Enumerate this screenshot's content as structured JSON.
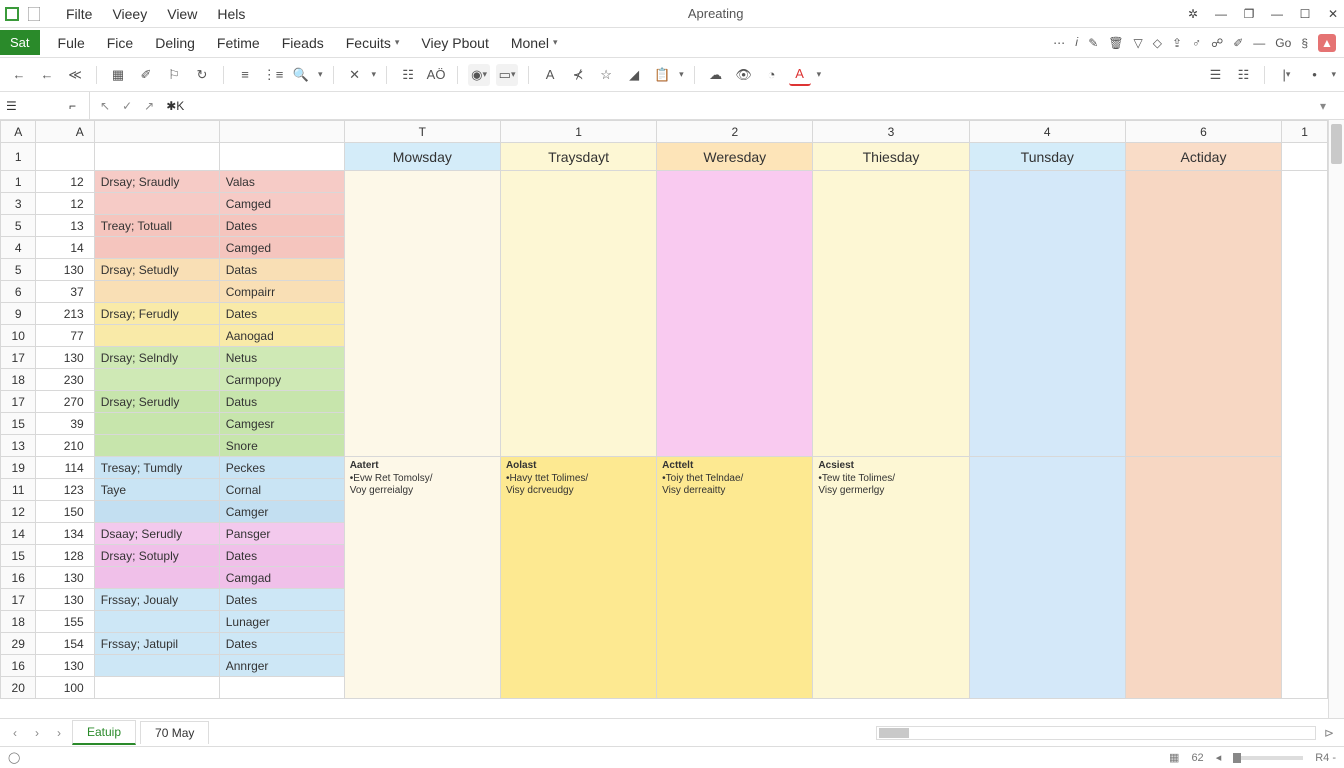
{
  "titlebar": {
    "menu": [
      "Filte",
      "Vieey",
      "View",
      "Hels"
    ],
    "center": "Apreating"
  },
  "ribbon": {
    "sat": "Sat",
    "items": [
      "Fule",
      "Fice",
      "Deling",
      "Fetime",
      "Fieads",
      "Fecuits",
      "Viey Pbout",
      "Monel"
    ],
    "go": "Go"
  },
  "formula": {
    "fx": "K"
  },
  "colHeaders": {
    "a1": "A",
    "a2": "A",
    "t": "T",
    "c1": "1",
    "c2": "2",
    "c3": "3",
    "c4": "4",
    "c6": "6",
    "c1r": "1"
  },
  "days": {
    "d1": "Mowsday",
    "d2": "Traysdayt",
    "d3": "Weresday",
    "d4": "Thiesday",
    "d5": "Tunsday",
    "d6": "Actiday"
  },
  "rows": [
    {
      "h": "1",
      "a": "",
      "b": "",
      "c": ""
    },
    {
      "h": "1",
      "a": "12",
      "b": "Drsay;  Sraudly",
      "c": "Valas",
      "cls": "c-red1"
    },
    {
      "h": "3",
      "a": "12",
      "b": "",
      "c": "Camged",
      "cls": "c-red1"
    },
    {
      "h": "5",
      "a": "13",
      "b": "Treay;  Totuall",
      "c": "Dates",
      "cls": "c-red2"
    },
    {
      "h": "4",
      "a": "14",
      "b": "",
      "c": "Camged",
      "cls": "c-red2"
    },
    {
      "h": "5",
      "a": "130",
      "b": "Drsay;  Setudly",
      "c": "Datas",
      "cls": "c-orn2"
    },
    {
      "h": "6",
      "a": "37",
      "b": "",
      "c": "Compairr",
      "cls": "c-orn2"
    },
    {
      "h": "9",
      "a": "213",
      "b": "Drsay;  Ferudly",
      "c": "Dates",
      "cls": "c-yel2"
    },
    {
      "h": "10",
      "a": "77",
      "b": "",
      "c": "Aanogad",
      "cls": "c-yel2"
    },
    {
      "h": "17",
      "a": "130",
      "b": "Drsay;  Selndly",
      "c": "Netus",
      "cls": "c-grn2"
    },
    {
      "h": "18",
      "a": "230",
      "b": "",
      "c": "Carmpopy",
      "cls": "c-grn2"
    },
    {
      "h": "17",
      "a": "270",
      "b": "Drsay;  Serudly",
      "c": "Datus",
      "cls": "c-grn3"
    },
    {
      "h": "15",
      "a": "39",
      "b": "",
      "c": "Camgesr",
      "cls": "c-grn3"
    },
    {
      "h": "13",
      "a": "210",
      "b": "",
      "c": "Snore",
      "cls": "c-grn3"
    },
    {
      "h": "19",
      "a": "114",
      "b": "Tresay;  Tumdly",
      "c": "Peckes",
      "cls": "c-blu3"
    },
    {
      "h": "11",
      "a": "123",
      "b": "Taye",
      "c": "Cornal",
      "cls": "c-blu3"
    },
    {
      "h": "12",
      "a": "150",
      "b": "",
      "c": "Camger",
      "cls": "c-blu4"
    },
    {
      "h": "14",
      "a": "134",
      "b": "Dsaay; Serudly",
      "c": "Pansger",
      "cls": "c-pnk2"
    },
    {
      "h": "15",
      "a": "128",
      "b": "Drsay;  Sotuply",
      "c": "Dates",
      "cls": "c-pnk3"
    },
    {
      "h": "16",
      "a": "130",
      "b": "",
      "c": "Camgad",
      "cls": "c-pnk3"
    },
    {
      "h": "17",
      "a": "130",
      "b": "Frssay;  Joualy",
      "c": "Dates",
      "cls": "c-blu5"
    },
    {
      "h": "18",
      "a": "155",
      "b": "",
      "c": "Lunager",
      "cls": "c-blu5"
    },
    {
      "h": "29",
      "a": "154",
      "b": "Frssay;  Jatupil",
      "c": "Dates",
      "cls": "c-blu5"
    },
    {
      "h": "16",
      "a": "130",
      "b": "",
      "c": "Annrger",
      "cls": "c-blu5"
    },
    {
      "h": "20",
      "a": "100",
      "b": "",
      "c": ""
    }
  ],
  "notes": {
    "n1": {
      "title": "Aatert",
      "l1": "•Evw Ret Tomolsy/",
      "l2": "Voy gerreialgy"
    },
    "n2": {
      "title": "Aolast",
      "l1": "•Havy ttet Tolimes/",
      "l2": "Visy dcrveudgy"
    },
    "n3": {
      "title": "Acttelt",
      "l1": "•Toiy thet Telndae/",
      "l2": "Visy derreaitty"
    },
    "n4": {
      "title": "Acsiest",
      "l1": "•Tew tite Tolimes/",
      "l2": "Visy germerlgy"
    }
  },
  "tabs": {
    "t1": "Eatuip",
    "t2": "70 May"
  },
  "status": {
    "zoom": "62",
    "rv": "R4 -"
  }
}
